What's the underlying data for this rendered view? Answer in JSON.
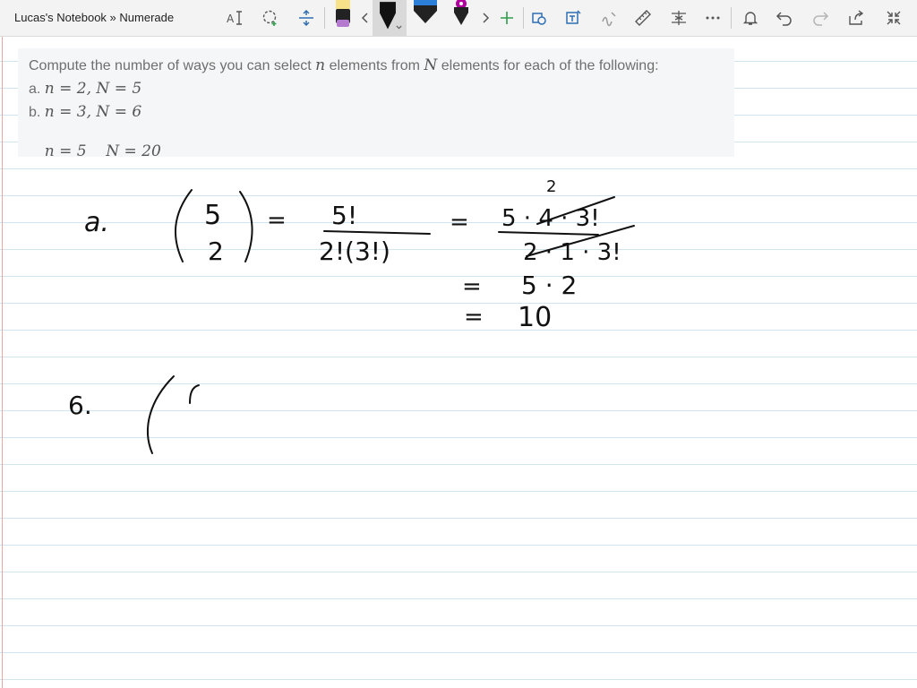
{
  "window": {
    "title": "Lucas's Notebook » Numerade"
  },
  "toolbar": {
    "tools": [
      {
        "icon": "text-to-ink-icon"
      },
      {
        "icon": "lasso-select-icon"
      },
      {
        "icon": "insert-space-icon"
      },
      {
        "icon": "highlighter-yellow-icon"
      },
      {
        "icon": "scroll-left-icon"
      },
      {
        "icon": "pen-black-icon"
      },
      {
        "icon": "pen-blue-icon"
      },
      {
        "icon": "pen-magenta-icon"
      },
      {
        "icon": "scroll-right-icon"
      },
      {
        "icon": "add-pen-icon"
      },
      {
        "icon": "ink-to-shape-icon"
      },
      {
        "icon": "ink-to-text-icon"
      },
      {
        "icon": "ink-to-math-icon"
      },
      {
        "icon": "ruler-icon"
      },
      {
        "icon": "math-tool-icon"
      },
      {
        "icon": "more-icon"
      },
      {
        "icon": "bell-icon"
      },
      {
        "icon": "undo-icon"
      },
      {
        "icon": "redo-icon"
      },
      {
        "icon": "share-icon"
      },
      {
        "icon": "collapse-icon"
      }
    ],
    "colors": {
      "pen_black": "#111111",
      "pen_blue": "#2b7fd8",
      "pen_magenta": "#b4009e",
      "highlighter": "#f7e28a",
      "add_accent": "#2e9e4a",
      "accent_icon": "#2f6fb3"
    }
  },
  "question": {
    "prompt_before": "Compute the number of ways you can select",
    "prompt_n": "n",
    "prompt_middle": "elements from",
    "prompt_N": "N",
    "prompt_after": "elements for each of the following:",
    "items": [
      {
        "label": "a.",
        "math": "n = 2, N = 5"
      },
      {
        "label": "b.",
        "math": "n = 3, N = 6"
      },
      {
        "label": "",
        "math": "n = 5    N = 20"
      }
    ]
  },
  "ink": {
    "part_a_label": "a.",
    "binom_top": "5",
    "binom_bottom": "2",
    "eq1": "=",
    "frac1_num": "5!",
    "frac1_den": "2!(3!)",
    "eq2": "=",
    "cancel_mark": "2",
    "frac2_num": "5 · 4 · 3!",
    "frac2_den": "2 · 1 · 3!",
    "eq3": "=",
    "step3": "5 · 2",
    "eq4": "=",
    "result": "10",
    "part_b_label": "6."
  }
}
